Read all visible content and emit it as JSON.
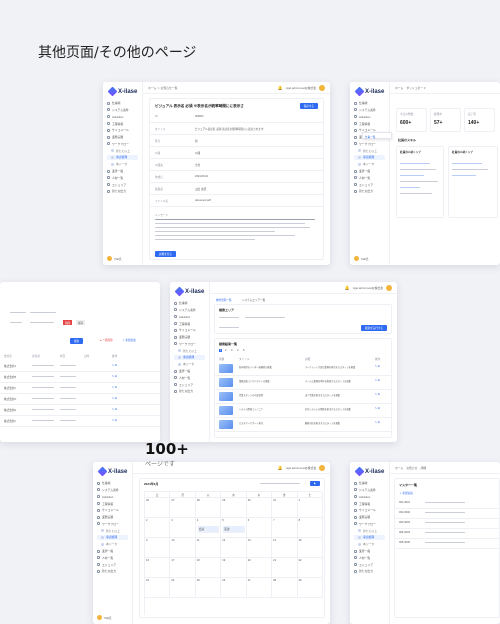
{
  "heading": "其他页面/その他のページ",
  "brand": "X-ilase",
  "user_header": "rigel.admin.test@株式会",
  "user_footer": "Yuki氏",
  "nav": [
    "仕事線",
    "システム案件",
    "Adviction",
    "工程情報",
    "サイコメール",
    "業務実積",
    "ワークフロー",
    "新たに以上",
    "承認処理",
    "本ジータ",
    "業界一般",
    "人材一覧",
    "エシュリア",
    "新たな出力"
  ],
  "screen_detail": {
    "breadcrumb": "ホーム ＞ お知らせ一覧",
    "title": "ビジュアル 表示名 必須 ※表示名が統率時間にに表示さ",
    "button": "保存する",
    "fields": [
      {
        "label": "ID",
        "value": "000001"
      },
      {
        "label": "タイトル",
        "value": "ビジュアル表示名 必須 表示名が統率時間にに表示されます"
      },
      {
        "label": "区分",
        "value": "新"
      },
      {
        "label": "公開",
        "value": "公開"
      },
      {
        "label": "公開先",
        "value": "全社"
      },
      {
        "label": "作成日",
        "value": "2024-06-01"
      },
      {
        "label": "投稿者",
        "value": "山田 太郎"
      },
      {
        "label": "ファイル名",
        "value": "document.pdf"
      }
    ],
    "body_label": "メッセージ",
    "footer_button": "詳細を見る"
  },
  "screen_dashboard": {
    "tabs": [
      "ホーム",
      "ダッシュボード"
    ],
    "stats": [
      {
        "label": "今日の件数",
        "value": "600+"
      },
      {
        "label": "処理中",
        "value": "57+"
      },
      {
        "label": "完了済",
        "value": "140+"
      }
    ],
    "section": "社員のスキル",
    "card_title": "社員の人材トップ",
    "tooltip": "仕事一覧"
  },
  "screen_list_left": {
    "tag_red": "削除",
    "tag_gray": "保存",
    "button": "検索",
    "headers": [
      "会社名",
      "担当者",
      "状況",
      "日時",
      "操作"
    ],
    "rows": [
      "株式会社A",
      "株式会社B",
      "株式会社C",
      "株式会社D",
      "株式会社E",
      "株式会社F"
    ]
  },
  "screen_search": {
    "tabs": [
      "物件管理一覧",
      "システムエリア一覧"
    ],
    "section": "検索エリア",
    "button": "検索を実行する",
    "result_title": "検索結果一覧",
    "pagination": [
      "1",
      "2",
      "3",
      "4",
      "5"
    ],
    "headers": [
      "画像",
      "タイトル",
      "詳細",
      "操作"
    ],
    "rows": [
      {
        "title": "新卒採用のリーダー候補者の募集",
        "desc": "マーケティング部の業務を担当するスタッフを募集"
      },
      {
        "title": "業務改善コンサルタントの募集",
        "desc": "チームの業務効率化を推進するスタッフを募集"
      },
      {
        "title": "営業スタッフの中途採用",
        "desc": "法人営業を担当するスタッフを募集"
      },
      {
        "title": "システム開発エンジニア",
        "desc": "社内システムの開発を担当するスタッフを募集"
      },
      {
        "title": "カスタマーサポート担当",
        "desc": "顧客対応を担当するスタッフを募集"
      }
    ]
  },
  "badge": {
    "count": "100+",
    "caption": "ページです"
  },
  "screen_calendar": {
    "title": "2024年6月",
    "weekdays": [
      "日",
      "月",
      "火",
      "水",
      "木",
      "金",
      "土"
    ],
    "days": [
      "26",
      "27",
      "28",
      "29",
      "30",
      "31",
      "1",
      "2",
      "3",
      "4",
      "5",
      "6",
      "7",
      "8",
      "9",
      "10",
      "11",
      "12",
      "13",
      "14",
      "15",
      "16",
      "17",
      "18",
      "19",
      "20",
      "21",
      "22",
      "23",
      "24",
      "25",
      "26",
      "27",
      "28",
      "29"
    ],
    "events": [
      "会議",
      "面談"
    ]
  },
  "screen_table_right": {
    "tabs": [
      "ホーム",
      "お知らせ",
      "詳細"
    ],
    "title": "マスター一覧",
    "link": "＋ 新規追加",
    "codes": [
      "001-0001",
      "002-0002",
      "003-0003",
      "004-0004",
      "005-0005"
    ]
  }
}
